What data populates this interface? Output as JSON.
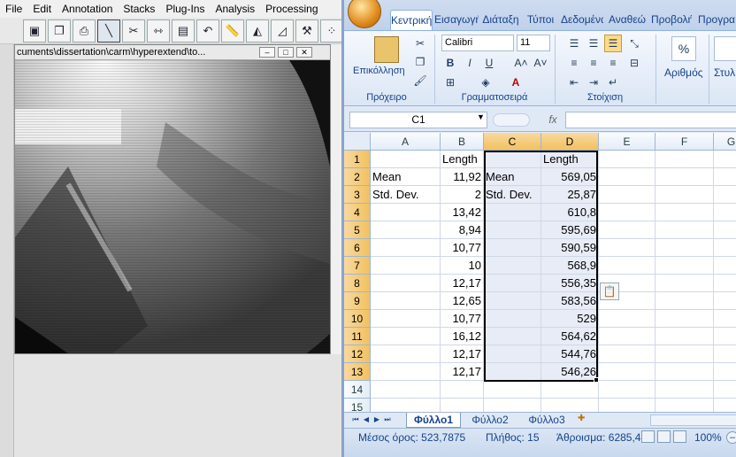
{
  "imagej": {
    "menus": [
      "File",
      "Edit",
      "Annotation",
      "Stacks",
      "Plug-Ins",
      "Analysis",
      "Processing"
    ],
    "tools": [
      {
        "icon": "open-folder-icon",
        "glyph": "▣"
      },
      {
        "icon": "copy-stack-icon",
        "glyph": "❐"
      },
      {
        "icon": "print-icon",
        "glyph": "⎙"
      },
      {
        "icon": "line-tool-icon",
        "glyph": "╲"
      },
      {
        "icon": "scissors-icon",
        "glyph": "✂"
      },
      {
        "icon": "resize-icon",
        "glyph": "⇿"
      },
      {
        "icon": "paste-icon",
        "glyph": "▤"
      },
      {
        "icon": "undo-icon",
        "glyph": "↶"
      },
      {
        "icon": "ruler-icon",
        "glyph": "📏"
      },
      {
        "icon": "freehand-icon",
        "glyph": "◭"
      },
      {
        "icon": "angle-icon",
        "glyph": "◿"
      },
      {
        "icon": "wand-icon",
        "glyph": "⚒"
      },
      {
        "icon": "points-icon",
        "glyph": "⁘"
      },
      {
        "icon": "wand-select-icon",
        "glyph": "✦"
      }
    ],
    "window_title": "cuments\\dissertation\\carm\\hyperextend\\to..."
  },
  "excel": {
    "tabs": [
      "Κεντρική",
      "Εισαγωγή",
      "Διάταξη",
      "Τύποι",
      "Δεδομένα",
      "Αναθεώ",
      "Προβολή",
      "Προγρα"
    ],
    "ribbon": {
      "clipboard_label": "Πρόχειρο",
      "paste_label": "Επικόλληση",
      "font_name": "Calibri",
      "font_size": "11",
      "font_group_label": "Γραμματοσειρά",
      "alignment_label": "Στοίχιση",
      "number_label": "Αριθμός",
      "styles_label": "Στυλ",
      "percent_glyph": "%"
    },
    "name_box": "C1",
    "fx": "fx",
    "columns": [
      "A",
      "B",
      "C",
      "D",
      "E",
      "F",
      "G"
    ],
    "rows": [
      {
        "n": "1",
        "A": "",
        "B": "Length",
        "C": "",
        "D": "Length"
      },
      {
        "n": "2",
        "A": "Mean",
        "B": "11,92",
        "C": "Mean",
        "D": "569,05"
      },
      {
        "n": "3",
        "A": "Std. Dev.",
        "B": "2",
        "C": "Std. Dev.",
        "D": "25,87"
      },
      {
        "n": "4",
        "A": "",
        "B": "13,42",
        "C": "",
        "D": "610,8"
      },
      {
        "n": "5",
        "A": "",
        "B": "8,94",
        "C": "",
        "D": "595,69"
      },
      {
        "n": "6",
        "A": "",
        "B": "10,77",
        "C": "",
        "D": "590,59"
      },
      {
        "n": "7",
        "A": "",
        "B": "10",
        "C": "",
        "D": "568,9"
      },
      {
        "n": "8",
        "A": "",
        "B": "12,17",
        "C": "",
        "D": "556,35"
      },
      {
        "n": "9",
        "A": "",
        "B": "12,65",
        "C": "",
        "D": "583,56"
      },
      {
        "n": "10",
        "A": "",
        "B": "10,77",
        "C": "",
        "D": "529"
      },
      {
        "n": "11",
        "A": "",
        "B": "16,12",
        "C": "",
        "D": "564,62"
      },
      {
        "n": "12",
        "A": "",
        "B": "12,17",
        "C": "",
        "D": "544,76"
      },
      {
        "n": "13",
        "A": "",
        "B": "12,17",
        "C": "",
        "D": "546,26"
      },
      {
        "n": "14",
        "A": "",
        "B": "",
        "C": "",
        "D": ""
      },
      {
        "n": "15",
        "A": "",
        "B": "",
        "C": "",
        "D": ""
      }
    ],
    "sheets": [
      "Φύλλο1",
      "Φύλλο2",
      "Φύλλο3"
    ],
    "status": {
      "average": "Μέσος όρος: 523,7875",
      "count": "Πλήθος: 15",
      "sum": "Άθροισμα: 6285,45",
      "zoom": "100%"
    },
    "colors": {
      "selection": "#f1c15f",
      "ribbon_text": "#15428b"
    }
  }
}
